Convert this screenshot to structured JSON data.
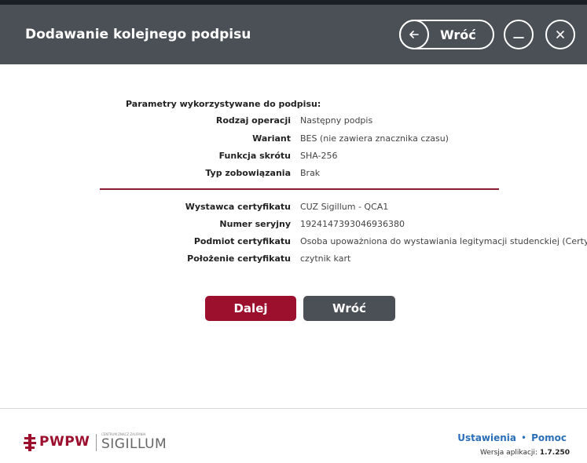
{
  "header": {
    "title": "Dodawanie kolejnego podpisu",
    "back_label": "Wróć",
    "icons": [
      "arrow-left-icon",
      "minimize-icon",
      "close-icon"
    ],
    "bg_color": "#4b5056"
  },
  "params": {
    "heading": "Parametry wykorzystywane do podpisu:",
    "rows": [
      {
        "label": "Rodzaj operacji",
        "value": "Następny podpis"
      },
      {
        "label": "Wariant",
        "value": "BES (nie zawiera znacznika czasu)"
      },
      {
        "label": "Funkcja skrótu",
        "value": "SHA-256"
      },
      {
        "label": "Typ zobowiązania",
        "value": "Brak"
      }
    ]
  },
  "certificate": {
    "rows": [
      {
        "label": "Wystawca certyfikatu",
        "value": "CUZ Sigillum - QCA1"
      },
      {
        "label": "Numer seryjny",
        "value": "1924147393046936380"
      },
      {
        "label": "Podmiot certyfikatu",
        "value": "Osoba upoważniona do wystawiania legitymacji studenckiej (Certyfika"
      },
      {
        "label": "Położenie certyfikatu",
        "value": "czytnik kart"
      }
    ]
  },
  "actions": {
    "next_label": "Dalej",
    "back_label": "Wróć",
    "next_color": "#9c0f2d",
    "back_color": "#4b5056"
  },
  "footer": {
    "logo_pwpw": "PWPW",
    "logo_small": "CENTRUM ZNACZ ZAUFANIA",
    "logo_sigillum": "SIGILLUM",
    "link_settings": "Ustawienia",
    "separator": "•",
    "link_help": "Pomoc",
    "version_label": "Wersja aplikacji:",
    "version_value": "1.7.250",
    "link_color": "#2b6fb8"
  }
}
